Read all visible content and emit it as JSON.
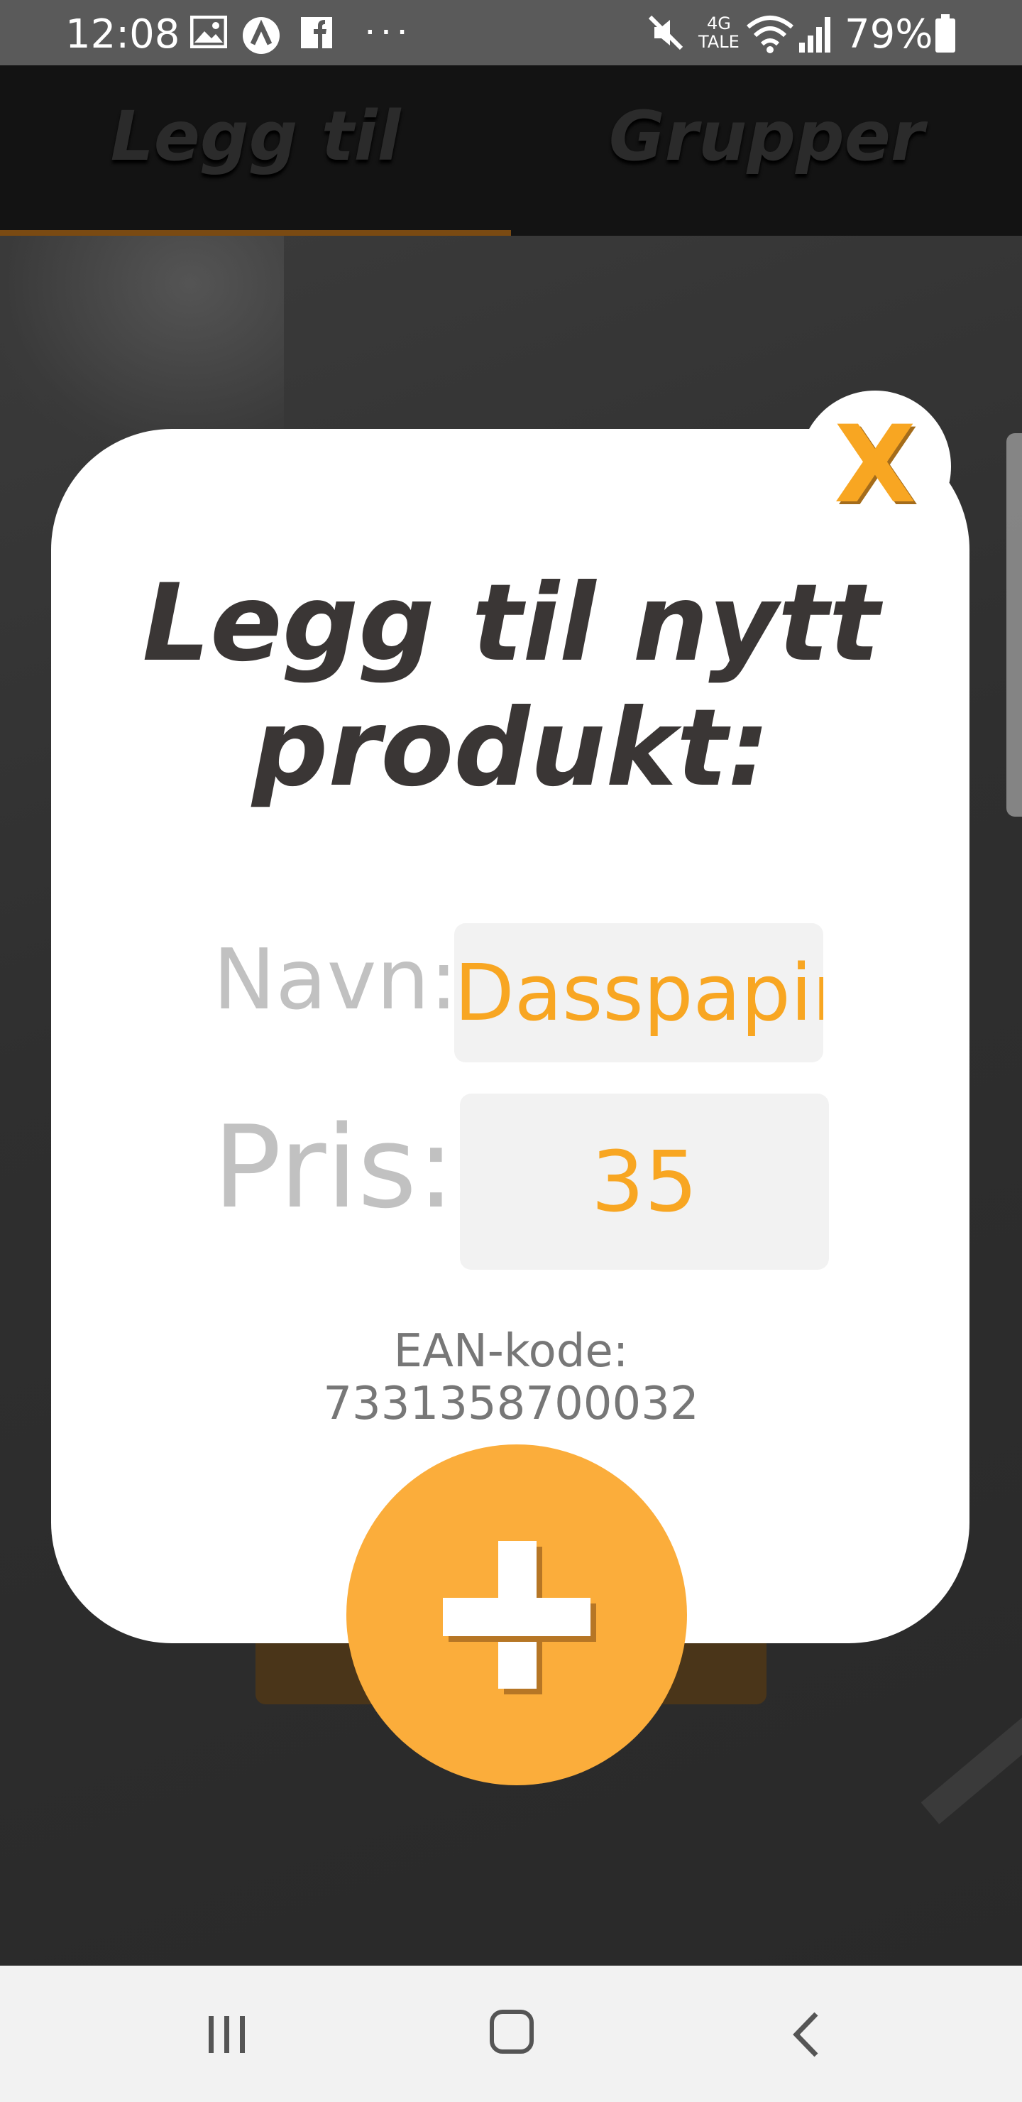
{
  "status_bar": {
    "time": "12:08",
    "network_top": "4G",
    "network_bottom": "TALE",
    "battery": "79%"
  },
  "tabs": [
    {
      "label": "Legg til",
      "active": true
    },
    {
      "label": "Grupper",
      "active": false
    }
  ],
  "dialog": {
    "close_label": "X",
    "title": "Legg til nytt produkt:",
    "name_label": "Navn:",
    "name_value": "Dasspapir",
    "price_label": "Pris:",
    "price_value": "35",
    "ean_text": "EAN-kode: 7331358700032"
  },
  "colors": {
    "accent": "#f8a622",
    "tab_bar": "#131313",
    "dialog_bg": "#ffffff",
    "field_bg": "#f2f2f2"
  },
  "icons": {
    "status_left": [
      "gallery-icon",
      "a-app-icon",
      "facebook-icon",
      "more-dots-icon"
    ],
    "status_right": [
      "mute-icon",
      "wifi-icon",
      "signal-icon",
      "battery-icon"
    ],
    "nav": [
      "recent-apps-icon",
      "home-icon",
      "back-icon"
    ]
  }
}
